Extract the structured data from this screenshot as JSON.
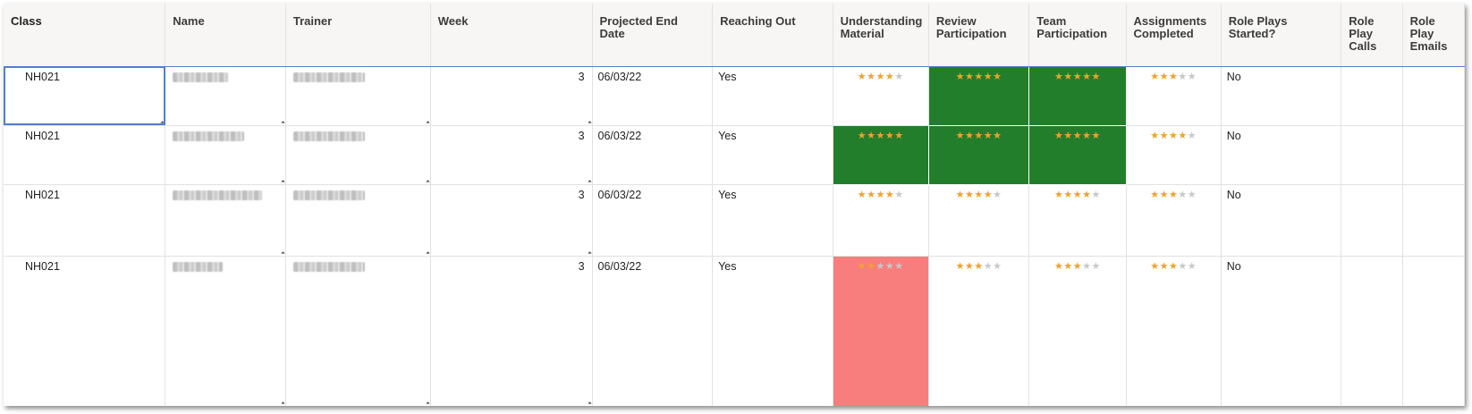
{
  "columns": [
    "Class",
    "Name",
    "Trainer",
    "Week",
    "Projected End Date",
    "Reaching Out",
    "Understanding Material",
    "Review Participation",
    "Team Participation",
    "Assignments Completed",
    "Role Plays Started?",
    "Role Play Calls",
    "Role Play Emails"
  ],
  "rows": [
    {
      "class": "NH021",
      "week": "3",
      "end_date": "06/03/22",
      "reaching_out": "Yes",
      "understanding": 4,
      "review": 5,
      "team": 5,
      "assignments": 3,
      "role_plays_started": "No",
      "understanding_bg": "none",
      "review_bg": "green",
      "team_bg": "green"
    },
    {
      "class": "NH021",
      "week": "3",
      "end_date": "06/03/22",
      "reaching_out": "Yes",
      "understanding": 5,
      "review": 5,
      "team": 5,
      "assignments": 4,
      "role_plays_started": "No",
      "understanding_bg": "green",
      "review_bg": "green",
      "team_bg": "green"
    },
    {
      "class": "NH021",
      "week": "3",
      "end_date": "06/03/22",
      "reaching_out": "Yes",
      "understanding": 4,
      "review": 4,
      "team": 4,
      "assignments": 3,
      "role_plays_started": "No",
      "understanding_bg": "none",
      "review_bg": "none",
      "team_bg": "none"
    },
    {
      "class": "NH021",
      "week": "3",
      "end_date": "06/03/22",
      "reaching_out": "Yes",
      "understanding": 2,
      "review": 3,
      "team": 3,
      "assignments": 3,
      "role_plays_started": "No",
      "understanding_bg": "red",
      "review_bg": "none",
      "team_bg": "none"
    }
  ],
  "rating_max": 5,
  "colors": {
    "star_filled": "#f0a22a",
    "star_empty": "#c8c8c8",
    "highlight_green": "#237e2c",
    "highlight_red": "#f87e7d",
    "selection": "#4f7fd0",
    "header_bg": "#f7f6f4"
  },
  "icons": {
    "star": "star-icon"
  }
}
